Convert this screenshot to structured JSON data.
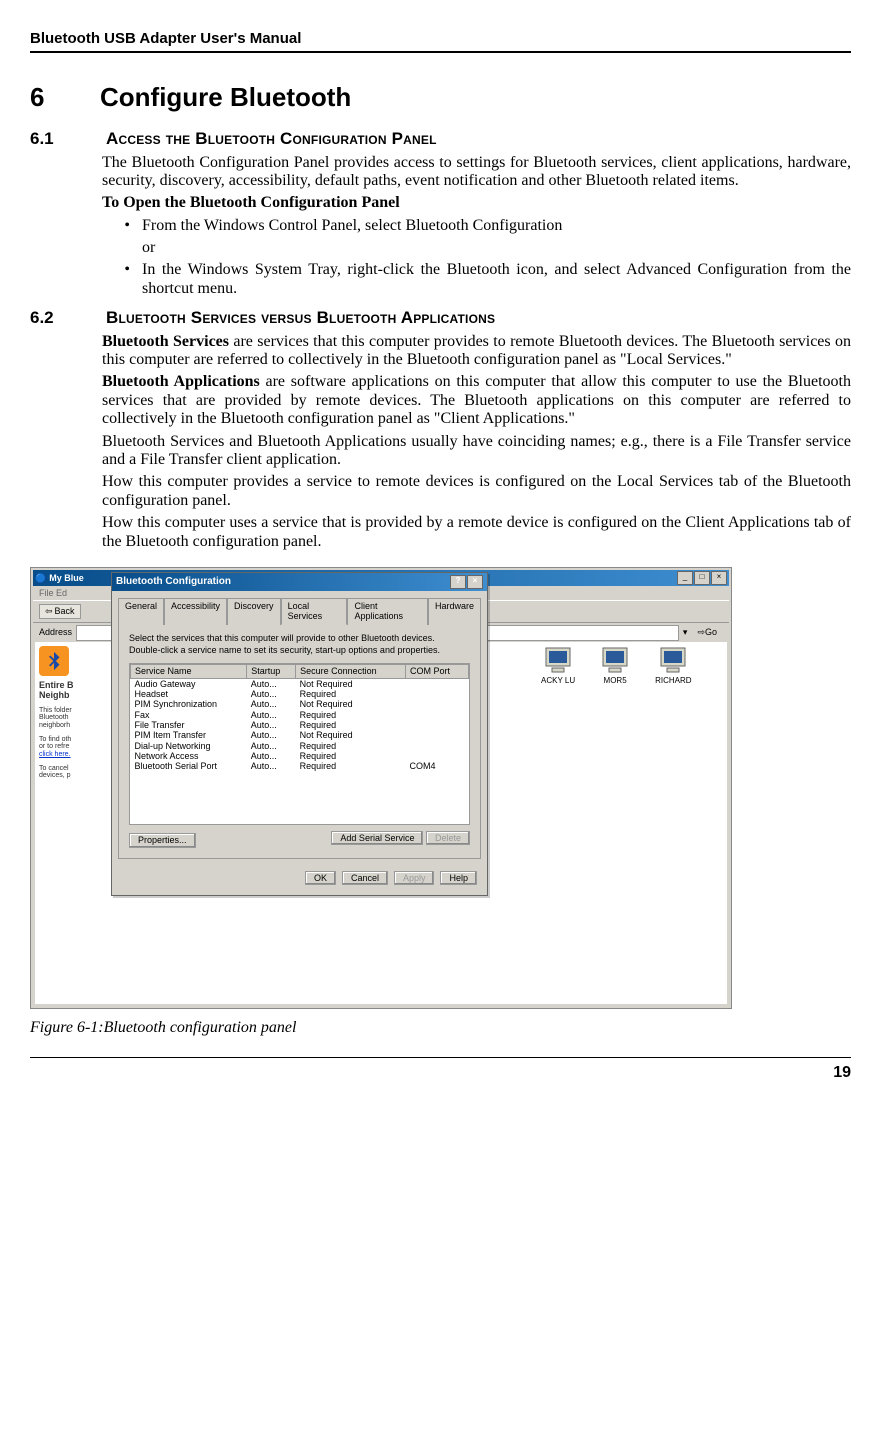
{
  "header": "Bluetooth USB Adapter User's Manual",
  "h1_num": "6",
  "h1_title": "Configure Bluetooth",
  "sec61": {
    "num": "6.1",
    "title": "Access the Bluetooth Configuration Panel",
    "p1": "The Bluetooth Configuration Panel provides access to settings for Bluetooth services, client applications, hardware, security, discovery, accessibility, default paths, event notification and other Bluetooth related items.",
    "p2": "To Open the Bluetooth Configuration Panel",
    "li1": "From the Windows Control Panel, select Bluetooth Configuration",
    "or": "or",
    "li2": "In the Windows System Tray, right-click the Bluetooth icon, and select Advanced Configuration from the shortcut menu."
  },
  "sec62": {
    "num": "6.2",
    "title": "Bluetooth Services versus Bluetooth Applications",
    "p1a": "Bluetooth Services",
    "p1b": " are services that this computer provides to remote Bluetooth devices. The Bluetooth services on this computer are referred to collectively in the Bluetooth configuration panel as \"Local Services.\"",
    "p2a": "Bluetooth Applications",
    "p2b": " are software applications on this computer that allow this computer to use the Bluetooth services that are provided by remote devices. The Bluetooth applications on this computer are referred to collectively in the Bluetooth configuration panel as \"Client Applications.\"",
    "p3": "Bluetooth Services and Bluetooth Applications usually have coinciding names; e.g., there is a File Transfer service and a File Transfer client application.",
    "p4": "How this computer provides a service to remote devices is configured on the Local Services tab of the Bluetooth configuration panel.",
    "p5": "How this computer uses a service that is provided by a remote device is configured on the Client Applications tab of the Bluetooth configuration panel."
  },
  "fig": {
    "bg_title": "My Blue",
    "bg_menubar": "File   Ed",
    "back": "Back",
    "addr_label": "Address",
    "go": "Go",
    "sidebar": {
      "title1": "Entire B",
      "title2": "Neighb",
      "text1": "This folder",
      "text2": "Bluetooth",
      "text3": "neighborh",
      "text4": "To find oth",
      "text5": "or to refre",
      "link": "click here.",
      "text6": "To cancel",
      "text7": "devices, p"
    },
    "devices": [
      "ACKY LU",
      "MOR5",
      "RICHARD"
    ],
    "dialog": {
      "title": "Bluetooth Configuration",
      "tabs": [
        "General",
        "Accessibility",
        "Discovery",
        "Local Services",
        "Client Applications",
        "Hardware"
      ],
      "active_tab": 3,
      "instr1": "Select the services that this computer will provide to other Bluetooth devices.",
      "instr2": "Double-click a service name to set its security, start-up options and properties.",
      "cols": [
        "Service Name",
        "Startup",
        "Secure Connection",
        "COM Port"
      ],
      "rows": [
        {
          "name": "Audio Gateway",
          "startup": "Auto...",
          "secure": "Not Required",
          "com": ""
        },
        {
          "name": "Headset",
          "startup": "Auto...",
          "secure": "Required",
          "com": ""
        },
        {
          "name": "PIM Synchronization",
          "startup": "Auto...",
          "secure": "Not Required",
          "com": ""
        },
        {
          "name": "Fax",
          "startup": "Auto...",
          "secure": "Required",
          "com": ""
        },
        {
          "name": "File Transfer",
          "startup": "Auto...",
          "secure": "Required",
          "com": ""
        },
        {
          "name": "PIM Item Transfer",
          "startup": "Auto...",
          "secure": "Not Required",
          "com": ""
        },
        {
          "name": "Dial-up Networking",
          "startup": "Auto...",
          "secure": "Required",
          "com": ""
        },
        {
          "name": "Network Access",
          "startup": "Auto...",
          "secure": "Required",
          "com": ""
        },
        {
          "name": "Bluetooth Serial Port",
          "startup": "Auto...",
          "secure": "Required",
          "com": "COM4"
        }
      ],
      "btn_props": "Properties...",
      "btn_add": "Add Serial Service",
      "btn_del": "Delete",
      "btn_ok": "OK",
      "btn_cancel": "Cancel",
      "btn_apply": "Apply",
      "btn_help": "Help"
    },
    "caption": "Figure 6-1:Bluetooth configuration panel"
  },
  "page_num": "19"
}
